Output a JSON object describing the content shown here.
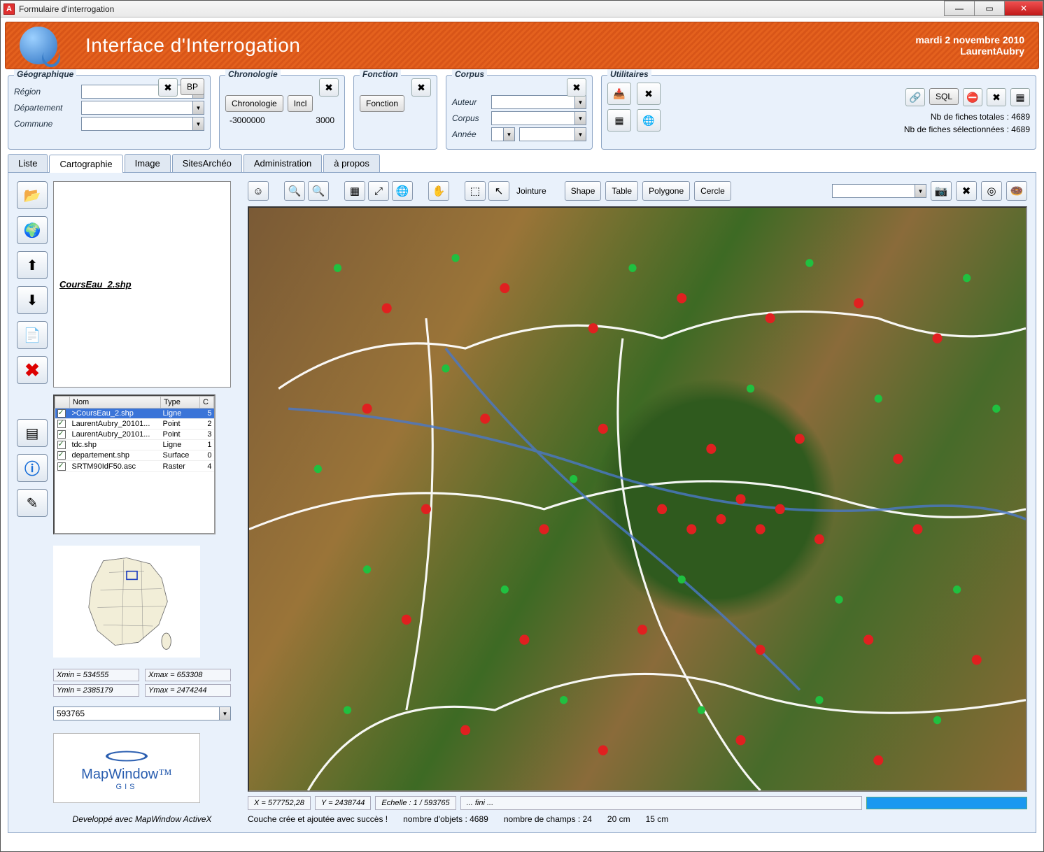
{
  "window": {
    "title": "Formulaire d'interrogation"
  },
  "header": {
    "title": "Interface d'Interrogation",
    "date": "mardi 2 novembre 2010",
    "user": "LaurentAubry"
  },
  "filters": {
    "geo": {
      "legend": "Géographique",
      "bp_btn": "BP",
      "region": "Région",
      "departement": "Département",
      "commune": "Commune"
    },
    "chrono": {
      "legend": "Chronologie",
      "btn1": "Chronologie",
      "btn2": "Incl",
      "min": "-3000000",
      "max": "3000"
    },
    "fonction": {
      "legend": "Fonction",
      "btn": "Fonction"
    },
    "corpus": {
      "legend": "Corpus",
      "auteur": "Auteur",
      "corpus": "Corpus",
      "annee": "Année"
    },
    "util": {
      "legend": "Utilitaires",
      "sql_btn": "SQL",
      "total_label": "Nb de fiches totales : ",
      "total_value": "4689",
      "sel_label": "Nb de fiches sélectionnées : ",
      "sel_value": "4689"
    }
  },
  "tabs": [
    "Liste",
    "Cartographie",
    "Image",
    "SitesArchéo",
    "Administration",
    "à propos"
  ],
  "active_tab": 1,
  "sidebar": {
    "current_file": "CoursEau_2.shp",
    "columns": [
      "Nom",
      "Type",
      "C"
    ],
    "layers": [
      {
        "nom": ">CoursEau_2.shp",
        "type": "Ligne",
        "c": "5",
        "sel": true
      },
      {
        "nom": "LaurentAubry_20101...",
        "type": "Point",
        "c": "2"
      },
      {
        "nom": "LaurentAubry_20101...",
        "type": "Point",
        "c": "3"
      },
      {
        "nom": "tdc.shp",
        "type": "Ligne",
        "c": "1"
      },
      {
        "nom": "departement.shp",
        "type": "Surface",
        "c": "0"
      },
      {
        "nom": "SRTM90IdF50.asc",
        "type": "Raster",
        "c": "4"
      }
    ],
    "extent": {
      "xmin": "Xmin = 534555",
      "xmax": "Xmax = 653308",
      "ymin": "Ymin = 2385179",
      "ymax": "Ymax = 2474244"
    },
    "scale_select": "593765",
    "logo_text": "MapWindow",
    "logo_sub": "GIS",
    "credit": "Developpé avec MapWindow ActiveX"
  },
  "toolbar": {
    "jointure": "Jointure",
    "shape": "Shape",
    "table": "Table",
    "polygone": "Polygone",
    "cercle": "Cercle"
  },
  "status": {
    "x": "X = 577752,28",
    "y": "Y = 2438744",
    "echelle": "Echelle : 1 / 593765",
    "fini": "... fini ...",
    "line": "Couche crée et ajoutée avec succès !",
    "nobj": "nombre d'objets : 4689",
    "nchamps": "nombre de champs : 24",
    "d1": "20 cm",
    "d2": "15 cm"
  }
}
